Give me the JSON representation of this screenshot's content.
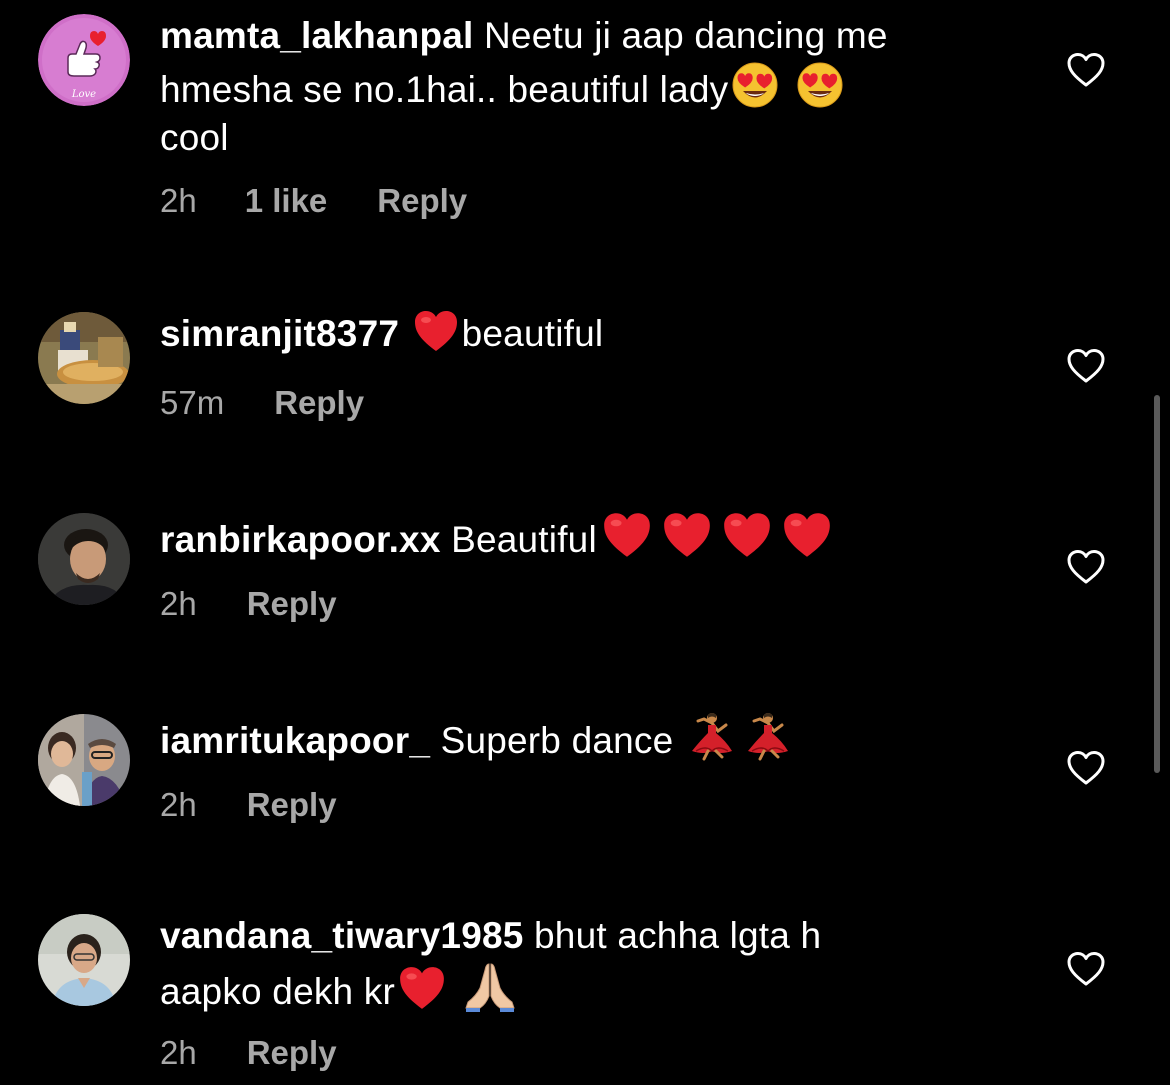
{
  "comments": [
    {
      "username": "mamta_lakhanpal",
      "text_line1": " Neetu ji aap dancing me",
      "text_line2": "hmesha se no.1hai.. beautiful lady",
      "text_line3": "cool",
      "time": "2h",
      "likes": "1 like",
      "reply": "Reply",
      "avatar_icon": "finger-heart-love-avatar",
      "emojis": [
        "heart-eyes-emoji",
        "heart-eyes-emoji"
      ]
    },
    {
      "username": "simranjit8377",
      "text": "beautiful",
      "time": "57m",
      "reply": "Reply",
      "avatar_icon": "temple-photo-avatar",
      "emojis": [
        "red-heart-emoji"
      ]
    },
    {
      "username": "ranbirkapoor.xx",
      "text": " Beautiful",
      "time": "2h",
      "reply": "Reply",
      "avatar_icon": "man-portrait-avatar",
      "emojis": [
        "red-heart-emoji",
        "red-heart-emoji",
        "red-heart-emoji",
        "red-heart-emoji"
      ]
    },
    {
      "username": "iamritukapoor_",
      "text": " Superb dance ",
      "time": "2h",
      "reply": "Reply",
      "avatar_icon": "two-people-avatar",
      "emojis": [
        "dancer-emoji",
        "dancer-emoji"
      ]
    },
    {
      "username": "vandana_tiwary1985",
      "text_line1": " bhut achha lgta h",
      "text_line2": "aapko dekh kr",
      "time": "2h",
      "reply": "Reply",
      "avatar_icon": "woman-portrait-avatar",
      "emojis": [
        "red-heart-emoji",
        "folded-hands-emoji"
      ]
    }
  ],
  "colors": {
    "background": "#000000",
    "text": "#ffffff",
    "meta": "#a8a8a8",
    "heart_red": "#e8202e",
    "scrollbar": "#5a5a5a"
  }
}
